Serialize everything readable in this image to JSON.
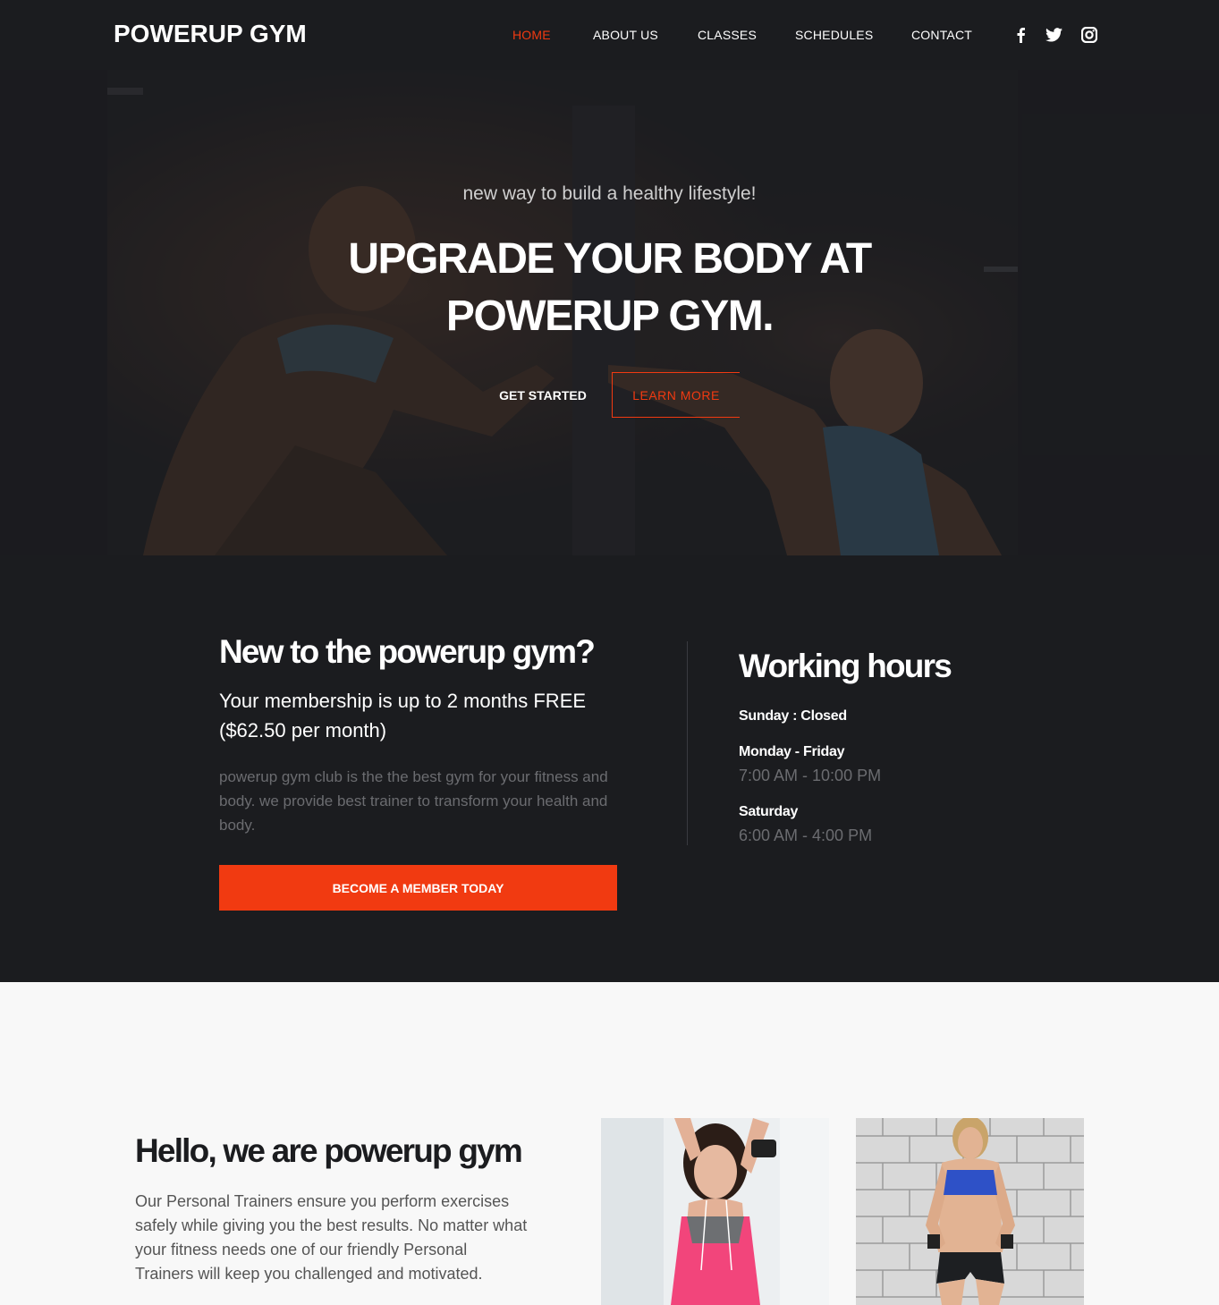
{
  "header": {
    "logo": "POWERUP GYM",
    "nav": [
      {
        "label": "HOME",
        "active": true
      },
      {
        "label": "ABOUT US",
        "active": false
      },
      {
        "label": "CLASSES",
        "active": false
      },
      {
        "label": "SCHEDULES",
        "active": false
      },
      {
        "label": "CONTACT",
        "active": false
      }
    ],
    "social_icons": [
      "facebook-icon",
      "twitter-icon",
      "instagram-icon"
    ]
  },
  "hero": {
    "subtitle": "new way to build a healthy lifestyle!",
    "title_line1": "UPGRADE YOUR BODY AT",
    "title_line2": "POWERUP GYM.",
    "btn_primary": "GET STARTED",
    "btn_secondary": "LEARN MORE"
  },
  "membership": {
    "title": "New to the powerup gym?",
    "offer": "Your membership is up to 2 months FREE ($62.50 per month)",
    "description": "powerup gym club is the the best gym for your fitness and body. we provide best trainer to transform your health and body.",
    "button": "BECOME A MEMBER TODAY"
  },
  "hours": {
    "title": "Working hours",
    "sunday": "Sunday : Closed",
    "weekday_label": "Monday - Friday",
    "weekday_time": "7:00 AM - 10:00 PM",
    "saturday_label": "Saturday",
    "saturday_time": "6:00 AM - 4:00 PM"
  },
  "about": {
    "title": "Hello, we are powerup gym",
    "description": "Our Personal Trainers ensure you perform exercises safely while giving you the best results. No matter what your fitness needs one of our friendly Personal Trainers will keep you challenged and motivated."
  },
  "colors": {
    "accent": "#f13a11",
    "dark_bg": "#1b1c1f",
    "light_bg": "#f8f8f8"
  }
}
